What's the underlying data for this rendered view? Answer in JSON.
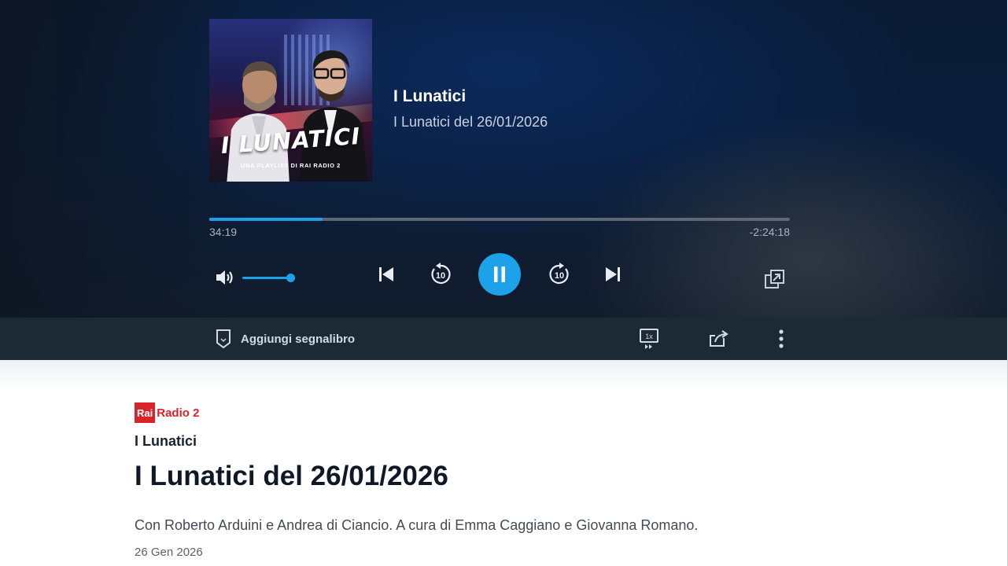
{
  "player": {
    "cover": {
      "title": "I LUNATICI",
      "subtitle": "UNA PLAYLIST DI RAI RADIO 2"
    },
    "show_title": "I Lunatici",
    "episode_title": "I Lunatici del 26/01/2026",
    "progress": {
      "fraction": 0.195,
      "elapsed": "34:19",
      "remaining": "-2:24:18"
    },
    "volume": {
      "level": 1.0,
      "icon": "volume-icon"
    },
    "controls": {
      "previous_icon": "skip-previous-icon",
      "rewind_icon": "rewind-10-icon",
      "rewind_label": "10",
      "play_icon": "pause-icon",
      "forward_icon": "forward-10-icon",
      "forward_label": "10",
      "next_icon": "skip-next-icon",
      "popout_icon": "popout-icon"
    },
    "accent_color": "#1da1e8"
  },
  "action_bar": {
    "bookmark_label": "Aggiungi segnalibro",
    "speed_label": "1x",
    "share_icon": "share-icon",
    "more_icon": "more-vertical-icon"
  },
  "detail": {
    "channel_logo_rai": "Rai",
    "channel_logo_name": "Radio 2",
    "program": "I Lunatici",
    "title": "I Lunatici del 26/01/2026",
    "description": "Con Roberto Arduini e Andrea di Ciancio. A cura di Emma Caggiano e Giovanna Romano.",
    "date": "26 Gen 2026",
    "brand_color": "#d8232a"
  }
}
